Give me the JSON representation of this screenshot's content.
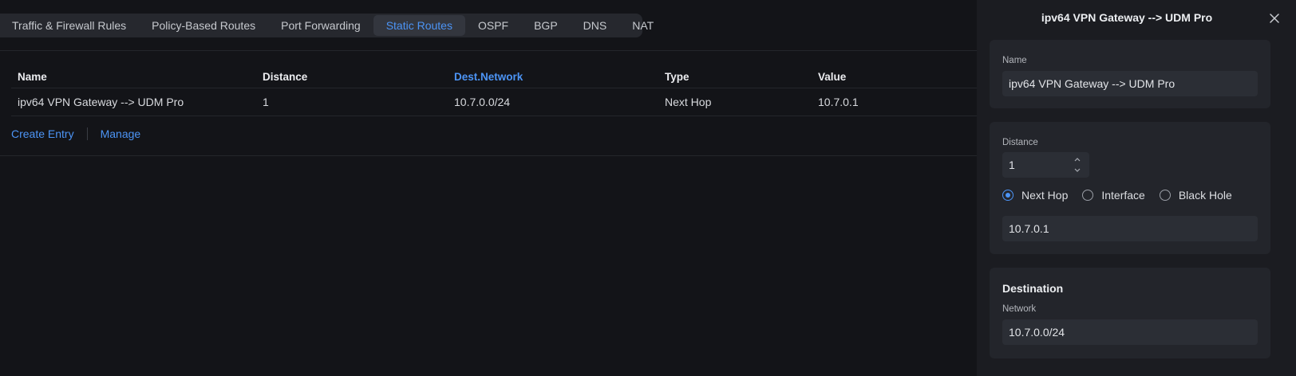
{
  "tabs": [
    "Traffic & Firewall Rules",
    "Policy-Based Routes",
    "Port Forwarding",
    "Static Routes",
    "OSPF",
    "BGP",
    "DNS",
    "NAT"
  ],
  "table": {
    "headers": [
      "Name",
      "Distance",
      "Dest.Network",
      "Type",
      "Value"
    ],
    "rows": [
      [
        "ipv64 VPN Gateway --> UDM Pro",
        "1",
        "10.7.0.0/24",
        "Next Hop",
        "10.7.0.1"
      ]
    ]
  },
  "actions": {
    "create": "Create Entry",
    "manage": "Manage"
  },
  "panel": {
    "title": "ipv64 VPN Gateway --> UDM Pro",
    "name_label": "Name",
    "name_value": "ipv64 VPN Gateway --> UDM Pro",
    "distance_label": "Distance",
    "distance_value": "1",
    "radios": [
      "Next Hop",
      "Interface",
      "Black Hole"
    ],
    "selected_radio": "Next Hop",
    "value": "10.7.0.1",
    "destination_title": "Destination",
    "network_label": "Network",
    "network_value": "10.7.0.0/24"
  },
  "colors": {
    "accent": "#4c94f5",
    "background": "#131418",
    "panel": "#1b1c21"
  }
}
